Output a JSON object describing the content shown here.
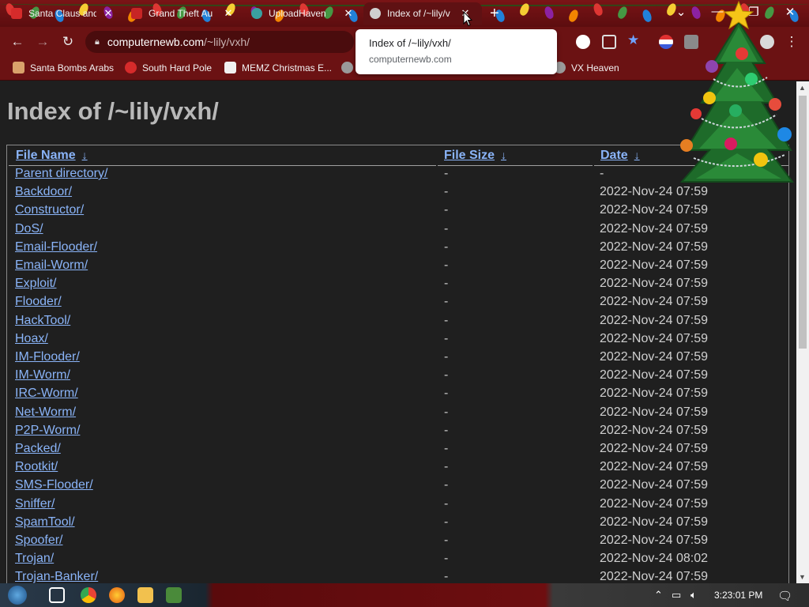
{
  "browser": {
    "tabs": [
      {
        "title": "Santa Claus and",
        "favicon_color": "#d62b2b"
      },
      {
        "title": "Grand Theft Au",
        "favicon_color": "#c72525"
      },
      {
        "title": "UploadHaven",
        "favicon_color": "#3aa0a0"
      },
      {
        "title": "Index of /~lily/v",
        "favicon_color": "#cfcfcf"
      }
    ],
    "tab_close_glyph": "✕",
    "new_tab_glyph": "+",
    "window_controls": [
      "⌄",
      "—",
      "❐",
      "✕"
    ],
    "nav": {
      "back": "←",
      "forward": "→",
      "reload": "↻"
    },
    "address": {
      "host": "computernewb.com",
      "path": "/~lily/vxh/"
    },
    "tooltip": {
      "title": "Index of /~lily/vxh/",
      "host": "computernewb.com"
    },
    "bookmarks": [
      {
        "label": "Santa Bombs Arabs",
        "icon_color": "#d9a26b"
      },
      {
        "label": "South Hard Pole",
        "icon_color": "#d62b2b"
      },
      {
        "label": "MEMZ Christmas E...",
        "icon_color": "#f0f0f0"
      },
      {
        "label": "VX Heaven",
        "icon_color": "#9a9a9a"
      }
    ]
  },
  "page": {
    "heading": "Index of /~lily/vxh/",
    "columns": {
      "name": "File Name",
      "size": "File Size",
      "date": "Date",
      "sort_glyph": "↓"
    },
    "rows": [
      {
        "name": "Parent directory/",
        "size": "-",
        "date": "-"
      },
      {
        "name": "Backdoor/",
        "size": "-",
        "date": "2022-Nov-24 07:59"
      },
      {
        "name": "Constructor/",
        "size": "-",
        "date": "2022-Nov-24 07:59"
      },
      {
        "name": "DoS/",
        "size": "-",
        "date": "2022-Nov-24 07:59"
      },
      {
        "name": "Email-Flooder/",
        "size": "-",
        "date": "2022-Nov-24 07:59"
      },
      {
        "name": "Email-Worm/",
        "size": "-",
        "date": "2022-Nov-24 07:59"
      },
      {
        "name": "Exploit/",
        "size": "-",
        "date": "2022-Nov-24 07:59"
      },
      {
        "name": "Flooder/",
        "size": "-",
        "date": "2022-Nov-24 07:59"
      },
      {
        "name": "HackTool/",
        "size": "-",
        "date": "2022-Nov-24 07:59"
      },
      {
        "name": "Hoax/",
        "size": "-",
        "date": "2022-Nov-24 07:59"
      },
      {
        "name": "IM-Flooder/",
        "size": "-",
        "date": "2022-Nov-24 07:59"
      },
      {
        "name": "IM-Worm/",
        "size": "-",
        "date": "2022-Nov-24 07:59"
      },
      {
        "name": "IRC-Worm/",
        "size": "-",
        "date": "2022-Nov-24 07:59"
      },
      {
        "name": "Net-Worm/",
        "size": "-",
        "date": "2022-Nov-24 07:59"
      },
      {
        "name": "P2P-Worm/",
        "size": "-",
        "date": "2022-Nov-24 07:59"
      },
      {
        "name": "Packed/",
        "size": "-",
        "date": "2022-Nov-24 07:59"
      },
      {
        "name": "Rootkit/",
        "size": "-",
        "date": "2022-Nov-24 07:59"
      },
      {
        "name": "SMS-Flooder/",
        "size": "-",
        "date": "2022-Nov-24 07:59"
      },
      {
        "name": "Sniffer/",
        "size": "-",
        "date": "2022-Nov-24 07:59"
      },
      {
        "name": "SpamTool/",
        "size": "-",
        "date": "2022-Nov-24 07:59"
      },
      {
        "name": "Spoofer/",
        "size": "-",
        "date": "2022-Nov-24 07:59"
      },
      {
        "name": "Trojan/",
        "size": "-",
        "date": "2022-Nov-24 08:02"
      },
      {
        "name": "Trojan-Banker/",
        "size": "-",
        "date": "2022-Nov-24 07:59"
      }
    ]
  },
  "taskbar": {
    "clock": "3:23:01 PM",
    "tray_icons": [
      "chevron-up-icon",
      "network-icon",
      "volume-icon",
      "notification-icon"
    ]
  },
  "colors": {
    "link": "#8ab4f8",
    "chrome_red": "#6b1213",
    "page_bg": "#1f1f1f"
  }
}
